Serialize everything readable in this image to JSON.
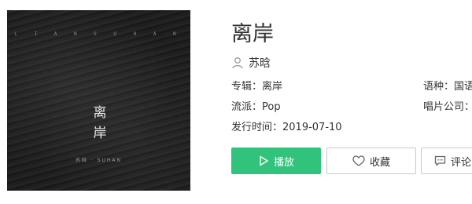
{
  "cover": {
    "top_text": "L I A N   S U H A N",
    "title": "离岸",
    "artist_line": "苏晗 · SUHAN"
  },
  "album": {
    "title": "离岸",
    "artist": "苏晗",
    "album_label": "专辑：",
    "album_value": "离岸",
    "genre_label": "流派：",
    "genre_value": "Pop",
    "release_label": "发行时间：",
    "release_value": "2019-07-10",
    "language_label": "语种：",
    "language_value": "国语",
    "company_label": "唱片公司：",
    "company_value": ""
  },
  "actions": {
    "play_label": "播放",
    "favorite_label": "收藏",
    "comment_label": "评论"
  },
  "colors": {
    "accent": "#31c27c"
  }
}
